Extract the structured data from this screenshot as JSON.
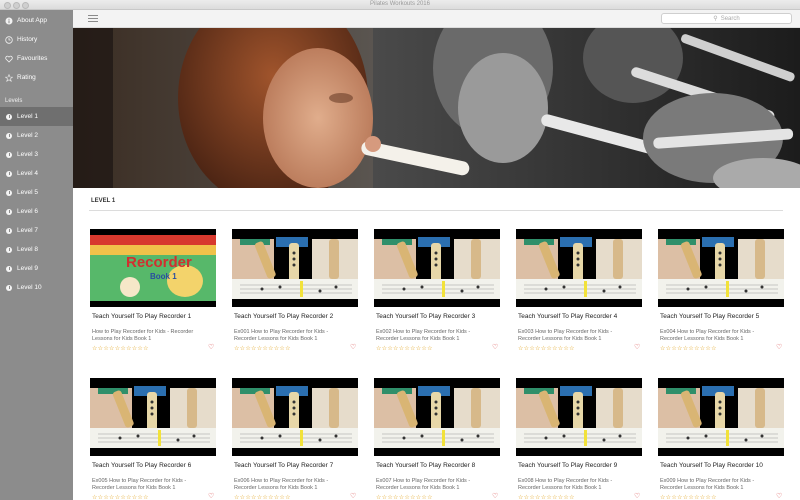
{
  "window": {
    "title": "Pilates Workouts 2016"
  },
  "sidebar": {
    "items": [
      {
        "label": "About App",
        "icon": "info-icon"
      },
      {
        "label": "History",
        "icon": "clock-icon"
      },
      {
        "label": "Favourites",
        "icon": "heart-icon"
      },
      {
        "label": "Rating",
        "icon": "star-icon"
      }
    ],
    "levels_heading": "Levels",
    "levels": [
      "Level 1",
      "Level 2",
      "Level 3",
      "Level 4",
      "Level 5",
      "Level 6",
      "Level 7",
      "Level 8",
      "Level 9",
      "Level 10"
    ],
    "active_level": "Level 1"
  },
  "toolbar": {
    "search_placeholder": "Search"
  },
  "section": {
    "title": "LEVEL 1"
  },
  "cards": [
    {
      "title": "Teach Yourself To Play Recorder 1",
      "desc": "How to Play Recorder for Kids - Recorder Lessons for Kids Book 1",
      "thumb": "cover"
    },
    {
      "title": "Teach Yourself To Play Recorder 2",
      "desc": "Ex001 How to Play Recorder for Kids - Recorder Lessons for Kids Book 1",
      "thumb": "lesson"
    },
    {
      "title": "Teach Yourself To Play Recorder 3",
      "desc": "Ex002 How to Play Recorder for Kids - Recorder Lessons for Kids Book 1",
      "thumb": "lesson"
    },
    {
      "title": "Teach Yourself To Play Recorder 4",
      "desc": "Ex003 How to Play Recorder for Kids - Recorder Lessons for Kids Book 1",
      "thumb": "lesson"
    },
    {
      "title": "Teach Yourself To Play Recorder 5",
      "desc": "Ex004 How to Play Recorder for Kids - Recorder Lessons for Kids Book 1",
      "thumb": "lesson"
    },
    {
      "title": "Teach Yourself To Play Recorder 6",
      "desc": "Ex005 How to Play Recorder for Kids - Recorder Lessons for Kids Book 1",
      "thumb": "lesson"
    },
    {
      "title": "Teach Yourself To Play Recorder 7",
      "desc": "Ex006 How to Play Recorder for Kids - Recorder Lessons for Kids Book 1",
      "thumb": "lesson"
    },
    {
      "title": "Teach Yourself To Play Recorder 8",
      "desc": "Ex007 How to Play Recorder for Kids - Recorder Lessons for Kids Book 1",
      "thumb": "lesson"
    },
    {
      "title": "Teach Yourself To Play Recorder 9",
      "desc": "Ex008 How to Play Recorder for Kids - Recorder Lessons for Kids Book 1",
      "thumb": "lesson"
    },
    {
      "title": "Teach Yourself To Play Recorder 10",
      "desc": "Ex009 How to Play Recorder for Kids - Recorder Lessons for Kids Book 1",
      "thumb": "lesson"
    }
  ],
  "thumb_cover_text": "Recorder",
  "thumb_cover_subtitle": "Book 1",
  "colors": {
    "sidebar": "#8c8c8c",
    "active": "#6f6f6f",
    "stars": "#e0a21a",
    "heart": "#d84a4a"
  },
  "rating": {
    "stars": 0,
    "max": 10
  }
}
